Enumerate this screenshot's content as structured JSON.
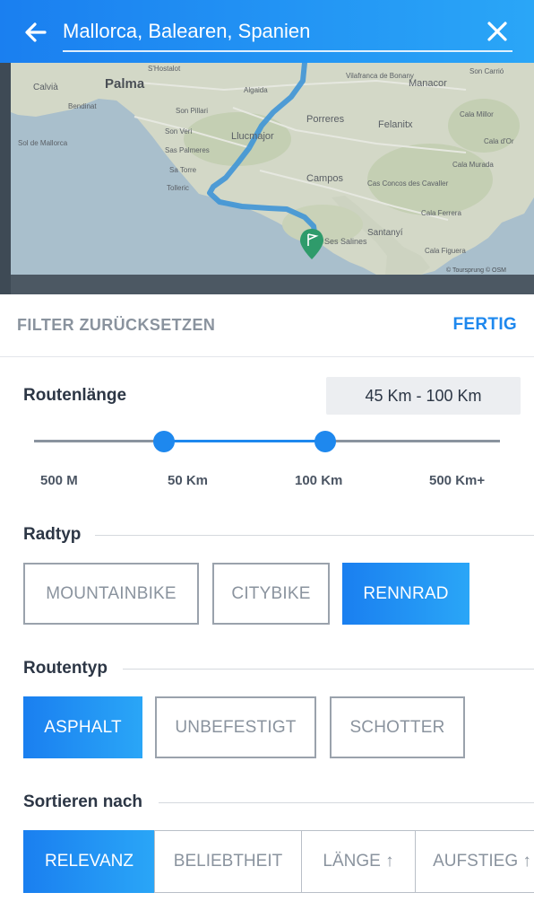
{
  "header": {
    "search_value": "Mallorca, Balearen, Spanien"
  },
  "map": {
    "towns": [
      "Palma",
      "Calvià",
      "Llucmajor",
      "Manacor",
      "Porreres",
      "Felanitx",
      "Campos",
      "Santanyí",
      "Ses Salines",
      "Cala d'Or",
      "Cala Millor",
      "Son Carrió",
      "Algaida",
      "Vilafranca de Bonany",
      "S'Hostalot",
      "Bendinat",
      "Sol de Mallorca",
      "Son Veri",
      "Son Pillari",
      "Sa Torre",
      "Tolleric",
      "Cas Concos des Cavaller",
      "Cala Murada",
      "Cala Ferrera",
      "Cala Figuera",
      "Sas Palmeres"
    ],
    "attribution": "© Toursprung  © OSM"
  },
  "filter": {
    "reset_label": "FILTER ZURÜCKSETZEN",
    "done_label": "FERTIG"
  },
  "route_length": {
    "label": "Routenlänge",
    "range_value": "45 Km - 100 Km",
    "ticks": [
      "500 M",
      "50 Km",
      "100 Km",
      "500 Km+"
    ]
  },
  "bike_type": {
    "label": "Radtyp",
    "options": [
      "MOUNTAINBIKE",
      "CITYBIKE",
      "RENNRAD"
    ],
    "selected": "RENNRAD"
  },
  "route_type": {
    "label": "Routentyp",
    "options": [
      "ASPHALT",
      "UNBEFESTIGT",
      "SCHOTTER"
    ],
    "selected": "ASPHALT"
  },
  "sort": {
    "label": "Sortieren nach",
    "options": [
      "RELEVANZ",
      "BELIEBTHEIT",
      "LÄNGE ↑",
      "AUFSTIEG ↑"
    ],
    "selected": "RELEVANZ"
  },
  "colors": {
    "accent": "#1e88ee",
    "accent_light": "#2aa6f7",
    "text_dark": "#2c3645",
    "text_muted": "#8a939e"
  }
}
